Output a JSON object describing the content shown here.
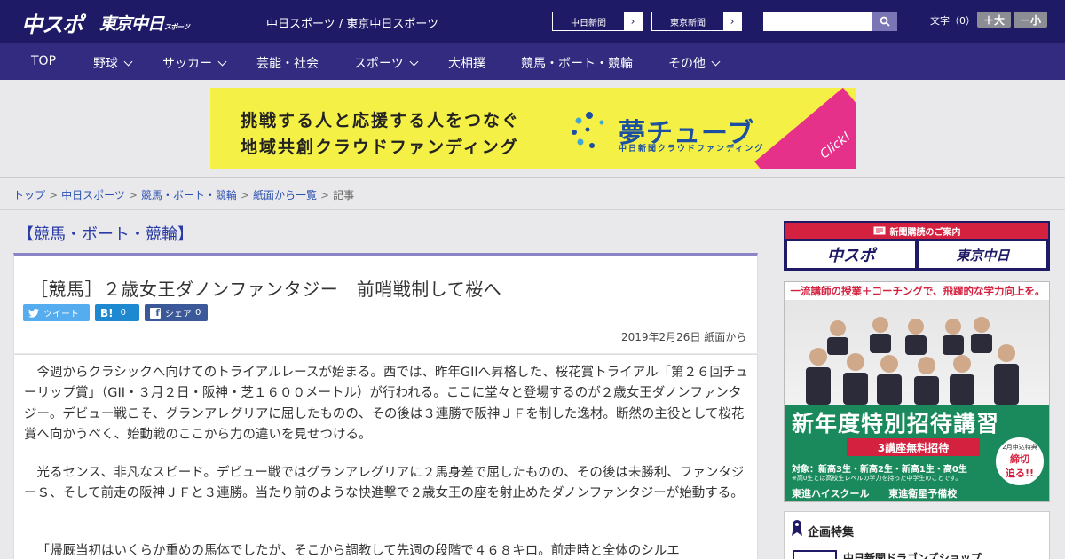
{
  "header": {
    "logo_chuspo": "中スポ",
    "logo_tokyo": "東京中日",
    "logo_tokyo_small": "スポーツ",
    "site_title": "中日スポーツ / 東京中日スポーツ",
    "link1": "中日新聞",
    "link2": "東京新聞",
    "arrow": "›",
    "fontsize_label": "文字（0）",
    "font_plus": "＋大",
    "font_minus": "－小"
  },
  "nav": {
    "items": [
      "TOP",
      "野球",
      "サッカー",
      "芸能・社会",
      "スポーツ",
      "大相撲",
      "競馬・ボート・競輪",
      "その他"
    ]
  },
  "banner": {
    "line1": "挑戦する人と応援する人をつなぐ",
    "line2": "地域共創クラウドファンディング",
    "logo": "夢チューブ",
    "sub": "中日新聞クラウドファンディング",
    "click": "Click!"
  },
  "breadcrumb": {
    "items": [
      "トップ",
      "中日スポーツ",
      "競馬・ボート・競輪",
      "紙面から一覧"
    ],
    "current": "記事",
    "sep": ">"
  },
  "section": {
    "head": "【競馬・ボート・競輪】"
  },
  "article": {
    "headline": "［競馬］２歳女王ダノンファンタジー　前哨戦制して桜へ",
    "share_twitter": "ツイート",
    "share_hatena": "B!",
    "share_hatena_count": "0",
    "share_facebook": "シェア",
    "share_facebook_count": "0",
    "date": "2019年2月26日 紙面から",
    "paragraphs": [
      "今週からクラシックへ向けてのトライアルレースが始まる。西では、昨年GIIへ昇格した、桜花賞トライアル「第２６回チューリップ賞」（GII・３月２日・阪神・芝１６００メートル）が行われる。ここに堂々と登場するのが２歳女王ダノンファンタジー。デビュー戦こそ、グランアレグリアに屈したものの、その後は３連勝で阪神ＪＦを制した逸材。断然の主役として桜花賞へ向かうべく、始動戦のここから力の違いを見せつける。",
      "光るセンス、非凡なスピード。デビュー戦ではグランアレグリアに２馬身差で屈したものの、その後は未勝利、ファンタジーＳ、そして前走の阪神ＪＦと３連勝。当たり前のような快進撃で２歳女王の座を射止めたダノンファンタジーが始動する。",
      "「帰厩当初はいくらか重めの馬体でしたが、そこから調教して先週の段階で４６８キロ。前走時と全体のシルエ"
    ]
  },
  "sidebar": {
    "sub_head": "新聞購読のご案内",
    "sub_logo1": "中スポ",
    "sub_logo2": "東京中日",
    "ad_top": "一流講師の授業＋コーチングで、飛躍的な学力向上を。",
    "ad_big": "新年度特別招待講習",
    "ad_red": "3講座無料招待",
    "ad_small": "対象：新高3生・新高2生・新高1生・高0生",
    "ad_tiny": "※高0生とは高校生レベルの学力を持った中学生のことです。",
    "ad_footer1": "東進ハイスクール",
    "ad_footer2": "東進衛星予備校",
    "ad_badge1": "2月申込特典",
    "ad_badge2": "締切",
    "ad_badge3": "迫る!!",
    "feature_title": "企画特集",
    "feature_item": "中日新聞ドラゴンズショップ"
  }
}
